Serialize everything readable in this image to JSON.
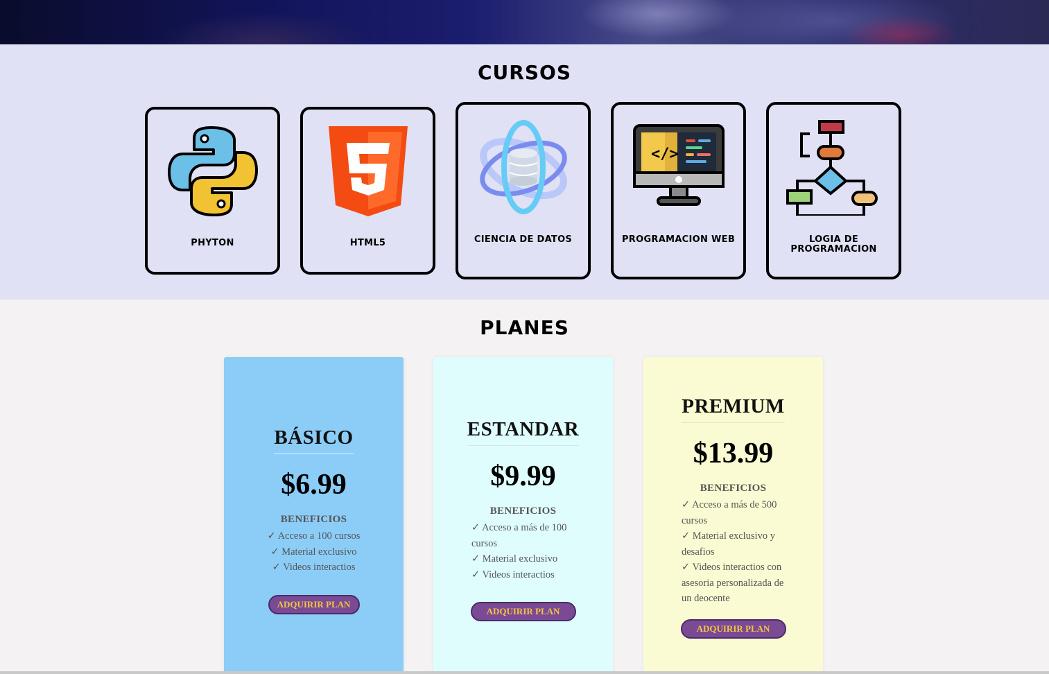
{
  "cursos": {
    "title": "CURSOS",
    "items": [
      {
        "label": "PHYTON",
        "icon": "python-logo-icon"
      },
      {
        "label": "HTML5",
        "icon": "html5-logo-icon"
      },
      {
        "label": "CIENCIA DE DATOS",
        "icon": "data-science-icon"
      },
      {
        "label": "PROGRAMACION WEB",
        "icon": "web-monitor-code-icon"
      },
      {
        "label": "LOGIA DE PROGRAMACION",
        "icon": "flowchart-icon"
      }
    ]
  },
  "planes": {
    "title": "PLANES",
    "plans": [
      {
        "name": "BÁSICO",
        "price": "$6.99",
        "benefits_title": "BENEFICIOS",
        "benefits": [
          "✓ Acceso a 100 cursos",
          "✓ Material exclusivo",
          "✓ Videos interactios"
        ],
        "button": "ADQUIRIR PLAN",
        "color": "#8ccdf8"
      },
      {
        "name": "ESTANDAR",
        "price": "$9.99",
        "benefits_title": "BENEFICIOS",
        "benefits": [
          "✓ Acceso a más de 100",
          "cursos",
          "✓ Material exclusivo",
          "✓ Videos interactios"
        ],
        "button": "ADQUIRIR PLAN",
        "color": "#e0fdfe"
      },
      {
        "name": "PREMIUM",
        "price": "$13.99",
        "benefits_title": "BENEFICIOS",
        "benefits": [
          "✓ Acceso a más de 500",
          "cursos",
          "✓ Material exclusivo y",
          "desafios",
          "✓ Videos interactios con",
          "asesoria personalizada de",
          "un deocente"
        ],
        "button": "ADQUIRIR PLAN",
        "color": "#fafbd2"
      }
    ]
  }
}
